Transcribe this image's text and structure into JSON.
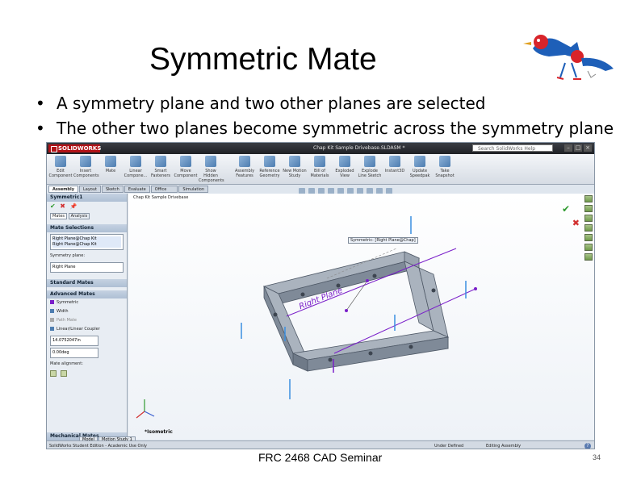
{
  "slide": {
    "title": "Symmetric Mate",
    "bullets": [
      "A symmetry plane and two other planes are selected",
      "The other two planes become symmetric across the symmetry plane"
    ],
    "footer": "FRC 2468 CAD Seminar",
    "page_number": "34"
  },
  "app": {
    "logo_text": "SOLIDWORKS",
    "document_title": "Chap Kit Sample Drivebase.SLDASM *",
    "search_placeholder": "Search SolidWorks Help",
    "window_buttons": [
      "–",
      "□",
      "×"
    ]
  },
  "ribbon": {
    "buttons": [
      "Edit Component",
      "Insert Components",
      "Mate",
      "Linear Compone...",
      "Smart Fasteners",
      "Move Component",
      "Show Hidden Components",
      "Assembly Features",
      "Reference Geometry",
      "New Motion Study",
      "Bill of Materials",
      "Exploded View",
      "Explode Line Sketch",
      "Instant3D",
      "Update Speedpak",
      "Take Snapshot"
    ]
  },
  "command_tabs": [
    "Assembly",
    "Layout",
    "Sketch",
    "Evaluate",
    "Office Products",
    "Simulation"
  ],
  "property_manager": {
    "header": "Symmetric1",
    "tabs": [
      "Mates",
      "Analysis"
    ],
    "mate_selections": {
      "title": "Mate Selections",
      "items": [
        "Right Plane@Chap Kit",
        "Right Plane@Chap Kit"
      ],
      "symmetry_label": "Symmetry plane:",
      "symmetry_value": "Right Plane"
    },
    "standard_mates_title": "Standard Mates",
    "advanced_mates": {
      "title": "Advanced Mates",
      "items": [
        "Symmetric",
        "Width",
        "Path Mate",
        "Linear/Linear Coupler"
      ],
      "distance_value": "14.0752047in",
      "angle_value": "0.00deg",
      "alignment_label": "Mate alignment:"
    },
    "mechanical_mates_title": "Mechanical Mates"
  },
  "viewport": {
    "breadcrumb": "Chap Kit Sample Drivebase",
    "callout": "Symmetric: [Right Plane@Chap]",
    "plane_label": "Right Plane",
    "orientation_label": "*Isometric"
  },
  "bottom_tabs": [
    "Model",
    "Motion Study 1"
  ],
  "status": {
    "left": "SolidWorks Student Edition - Academic Use Only",
    "state": "Under Defined",
    "mode": "Editing Assembly",
    "help": "?"
  },
  "colors": {
    "frame": "#7f8a98",
    "frame_dark": "#4e5866",
    "plane": "#7a1fc9",
    "handle": "#3a8fe0",
    "accept": "#2e9a2e",
    "cancel": "#d23030"
  },
  "icons": [
    "confirm-icon",
    "cancel-icon",
    "pushpin-icon",
    "help-icon",
    "triad-icon",
    "logo-bird-icon"
  ]
}
